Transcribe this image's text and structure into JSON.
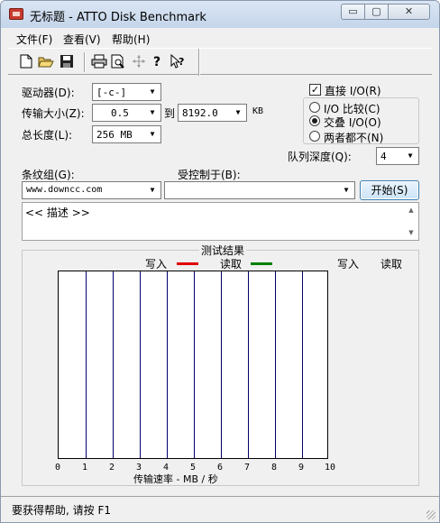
{
  "window": {
    "title": "无标题 - ATTO Disk Benchmark",
    "min_glyph": "▭",
    "max_glyph": "▢",
    "close_glyph": "✕"
  },
  "menu": [
    "文件(F)",
    "查看(V)",
    "帮助(H)"
  ],
  "toolbar": [
    "new-icon",
    "open-icon",
    "save-icon",
    "print-icon",
    "print-preview-icon",
    "move-icon",
    "help-icon",
    "context-help-icon"
  ],
  "form": {
    "drive_label": "驱动器(D):",
    "drive_value": "[-c-]",
    "transfer_label": "传输大小(Z):",
    "transfer_from": "0.5",
    "to_label": "到",
    "transfer_to": "8192.0",
    "kb_label": "KB",
    "total_label": "总长度(L):",
    "total_value": "256 MB",
    "direct_io_label": "直接 I/O(R)",
    "direct_io_checked": true,
    "io_compare_label": "I/O 比较(C)",
    "overlap_io_label": "交叠 I/O(O)",
    "neither_label": "两者都不(N)",
    "queue_label": "队列深度(Q):",
    "queue_value": "4",
    "stripe_label": "条纹组(G):",
    "stripe_value": "www.downcc.com",
    "controlled_label": "受控制于(B):",
    "controlled_value": "",
    "start_label": "开始(S)",
    "desc_text": "<< 描述 >>"
  },
  "results": {
    "title": "测试结果",
    "write_legend": "写入",
    "read_legend": "读取",
    "write_color": "#e00000",
    "read_color": "#008000",
    "write_col": "写入",
    "read_col": "读取",
    "x_ticks": [
      "0",
      "1",
      "2",
      "3",
      "4",
      "5",
      "6",
      "7",
      "8",
      "9",
      "10"
    ],
    "xlabel": "传输速率 - MB / 秒"
  },
  "status": "要获得帮助, 请按 F1"
}
